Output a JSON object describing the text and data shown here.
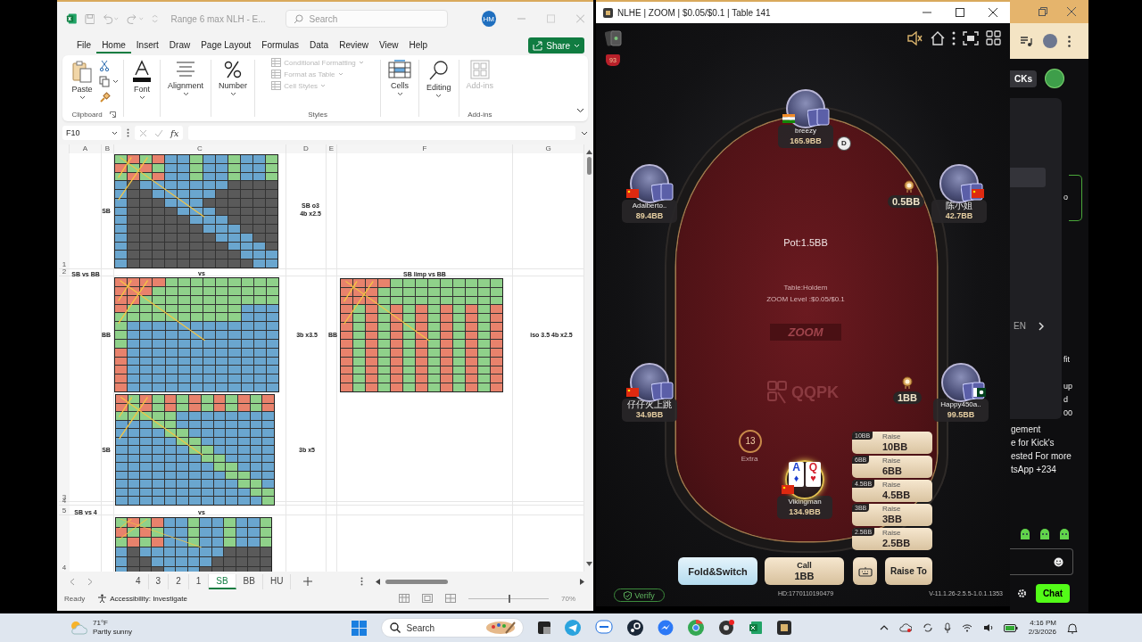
{
  "excel": {
    "title": "Range 6 max NLH - E...",
    "search": {
      "placeholder": "Search"
    },
    "account": "HM",
    "menu": [
      {
        "label": "File",
        "selected": false
      },
      {
        "label": "Home",
        "selected": true
      },
      {
        "label": "Insert",
        "selected": false
      },
      {
        "label": "Draw",
        "selected": false
      },
      {
        "label": "Page Layout",
        "selected": false
      },
      {
        "label": "Formulas",
        "selected": false
      },
      {
        "label": "Data",
        "selected": false
      },
      {
        "label": "Review",
        "selected": false
      },
      {
        "label": "View",
        "selected": false
      },
      {
        "label": "Help",
        "selected": false
      }
    ],
    "share": "Share",
    "ribbon": {
      "paste": "Paste",
      "clipboard": "Clipboard",
      "font": "Font",
      "alignment": "Alignment",
      "number": "Number",
      "styles": [
        {
          "label": "Conditional Formatting",
          "disabled": true
        },
        {
          "label": "Format as Table",
          "disabled": true
        },
        {
          "label": "Cell Styles",
          "disabled": true
        }
      ],
      "styles_group": "Styles",
      "cells": "Cells",
      "editing": "Editing",
      "addins": {
        "label": "Add-ins",
        "disabled": true
      },
      "addins_group": "Add-ins"
    },
    "name_box": "F10",
    "fx": "fx",
    "columns": [
      "A",
      "B",
      "C",
      "D",
      "E",
      "F",
      "G"
    ],
    "rows": [
      "1",
      "2",
      "3",
      "4",
      "5",
      "4"
    ],
    "cells": [
      "SB",
      "SB o3\n4b x2.5",
      "SB vs BB",
      "vs",
      "SB limp vs BB",
      "BB",
      "3b x3.5",
      "BB",
      "iso 3.5 4b x2.5",
      "SB",
      "3b x5",
      "SB vs 4",
      "vs"
    ],
    "sheet_tabs": [
      {
        "label": "4",
        "selected": false
      },
      {
        "label": "3",
        "selected": false
      },
      {
        "label": "2",
        "selected": false
      },
      {
        "label": "1",
        "selected": false
      },
      {
        "label": "SB",
        "selected": true
      },
      {
        "label": "BB",
        "selected": false
      },
      {
        "label": "HU",
        "selected": false
      }
    ],
    "status": {
      "ready": "Ready",
      "accessibility": "Accessibility: Investigate"
    },
    "zoom_slider": {
      "level": 0.5
    },
    "zoom_percent": "70%"
  },
  "poker": {
    "title": "NLHE | ZOOM | $0.05/$0.1 | Table 141",
    "level_badge": "93",
    "seats": [
      {
        "name": "breezy",
        "stack": "165.9BB",
        "kind": "opponent"
      },
      {
        "name": "Adalberto..",
        "stack": "89.4BB",
        "kind": "opponent"
      },
      {
        "name": "陈小姐",
        "stack": "42.7BB",
        "kind": "opponent"
      },
      {
        "name": "仔仔火上跳",
        "stack": "34.9BB",
        "kind": "opponent"
      },
      {
        "name": "Happy450a..",
        "stack": "99.5BB",
        "kind": "opponent"
      },
      {
        "name": "Vikingman",
        "stack": "134.9BB",
        "kind": "hero"
      }
    ],
    "hero_cards": [
      {
        "rank": "A",
        "suit": "♦",
        "color": "#1d3fcf"
      },
      {
        "rank": "Q",
        "suit": "♥",
        "color": "#d4202c"
      }
    ],
    "dealer": "D",
    "bets": [
      "0.5BB",
      "1BB"
    ],
    "pot": "Pot:1.5BB",
    "table_info": [
      "Table:Holdem",
      "ZOOM Level :$0.05/$0.1"
    ],
    "felt_logos": {
      "zoom": "ZOOM",
      "brand": "QQPK"
    },
    "timer": {
      "seconds": "13",
      "label": "Extra"
    },
    "raise_presets": [
      {
        "tag": "10BB",
        "label": "Raise",
        "amount": "10BB"
      },
      {
        "tag": "6BB",
        "label": "Raise",
        "amount": "6BB"
      },
      {
        "tag": "4.5BB",
        "label": "Raise",
        "amount": "4.5BB"
      },
      {
        "tag": "3BB",
        "label": "Raise",
        "amount": "3BB"
      },
      {
        "tag": "2.5BB",
        "label": "Raise",
        "amount": "2.5BB"
      }
    ],
    "fold": {
      "label": "Fold&Switch",
      "hovered": true
    },
    "call": {
      "label": "Call",
      "amount": "1BB"
    },
    "raise_to": "Raise To",
    "verify": "Verify",
    "hand_id": "HD:1770110190479",
    "version": "V-11.1.26-2.5.5-1.0.1.1353"
  },
  "browser": {
    "button": "CKs",
    "language": "EN",
    "edge_fragments": [
      "o",
      "fit",
      "up",
      "d",
      "00"
    ],
    "chat_lines": [
      "gement",
      "e for Kick's",
      "ested For more",
      "tsApp +234"
    ],
    "chat_button": "Chat"
  },
  "taskbar": {
    "weather": {
      "temp": "71°F",
      "condition": "Partly sunny"
    },
    "search": {
      "placeholder": "Search"
    },
    "time": "4:16 PM",
    "date": "2/3/2026"
  }
}
